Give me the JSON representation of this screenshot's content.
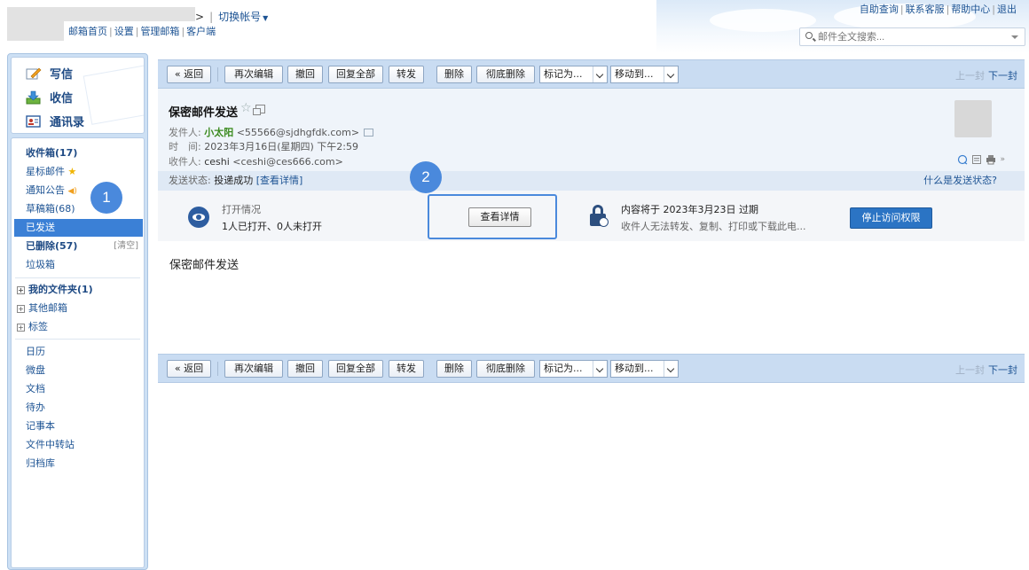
{
  "header": {
    "account_suffix": ">",
    "switch_account": "切换帐号",
    "links": [
      "邮箱首页",
      "设置",
      "管理邮箱",
      "客户端"
    ],
    "top_right_links": [
      "自助查询",
      "联系客服",
      "帮助中心",
      "退出"
    ],
    "search_placeholder": "邮件全文搜索..."
  },
  "sidebar": {
    "quick": {
      "compose": "写信",
      "inbox": "收信",
      "contacts": "通讯录"
    },
    "folders": {
      "inbox": "收件箱(17)",
      "starred": "星标邮件",
      "notice": "通知公告",
      "drafts": "草稿箱(68)",
      "sent": "已发送",
      "deleted": "已删除(57)",
      "clear": "[清空]",
      "junk": "垃圾箱",
      "my_folders": "我的文件夹(1)",
      "other_mailbox": "其他邮箱",
      "tags": "标签",
      "calendar": "日历",
      "drive": "微盘",
      "docs": "文档",
      "todo": "待办",
      "notes": "记事本",
      "transfer": "文件中转站",
      "archive": "归档库"
    }
  },
  "toolbar": {
    "back": "« 返回",
    "reedit": "再次编辑",
    "recall": "撤回",
    "reply_all": "回复全部",
    "forward": "转发",
    "delete": "删除",
    "delete_perm": "彻底删除",
    "mark_as": "标记为...",
    "move_to": "移动到...",
    "prev": "上一封",
    "next": "下一封"
  },
  "mail": {
    "subject": "保密邮件发送",
    "from_label": "发件人:",
    "from_name": "小太阳",
    "from_addr": "<55566@sjdhgfdk.com>",
    "time_label": "时　间:",
    "time_value": "2023年3月16日(星期四) 下午2:59",
    "to_label": "收件人:",
    "to_name": "ceshi",
    "to_addr": "<ceshi@ces666.com>",
    "status_label": "发送状态:",
    "status_value": "投递成功",
    "status_detail": "[查看详情]",
    "status_help": "什么是发送状态?",
    "open_title": "打开情况",
    "open_value": "1人已打开、0人未打开",
    "view_detail": "查看详情",
    "expire_title": "内容将于 2023年3月23日 过期",
    "expire_desc": "收件人无法转发、复制、打印或下载此电...",
    "stop_access": "停止访问权限",
    "body": "保密邮件发送"
  },
  "callouts": {
    "one": "1",
    "two": "2"
  },
  "colors": {
    "accent": "#2b74c4",
    "sidebar_bg": "#cde0f4",
    "callout": "#4a89dc",
    "active_folder": "#3b80d6"
  }
}
